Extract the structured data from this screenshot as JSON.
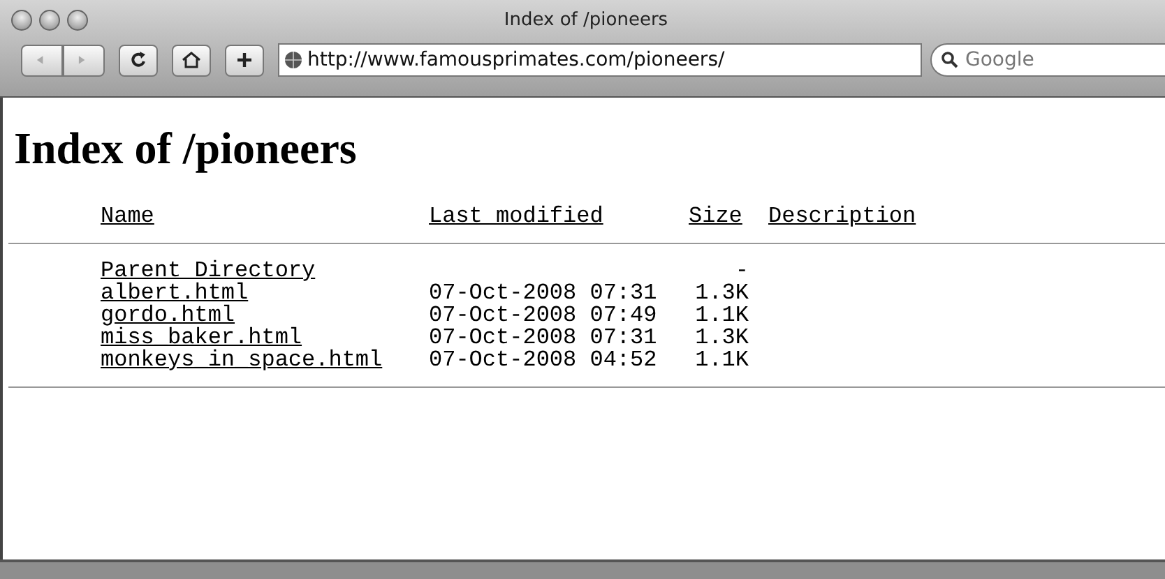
{
  "window": {
    "title": "Index of /pioneers"
  },
  "toolbar": {
    "url": "http://www.famousprimates.com/pioneers/",
    "search": {
      "placeholder": "Google"
    }
  },
  "heading": "Index of /pioneers",
  "table": {
    "columns": [
      "Name",
      "Last modified",
      "Size",
      "Description"
    ],
    "rows": [
      {
        "name": "Parent Directory",
        "modified": "",
        "size": "-"
      },
      {
        "name": "albert.html",
        "modified": "07-Oct-2008 07:31",
        "size": "1.3K"
      },
      {
        "name": "gordo.html",
        "modified": "07-Oct-2008 07:49",
        "size": "1.1K"
      },
      {
        "name": "miss_baker.html",
        "modified": "07-Oct-2008 07:31",
        "size": "1.3K"
      },
      {
        "name": "monkeys_in_space.html",
        "modified": "07-Oct-2008 04:52",
        "size": "1.1K"
      }
    ]
  }
}
